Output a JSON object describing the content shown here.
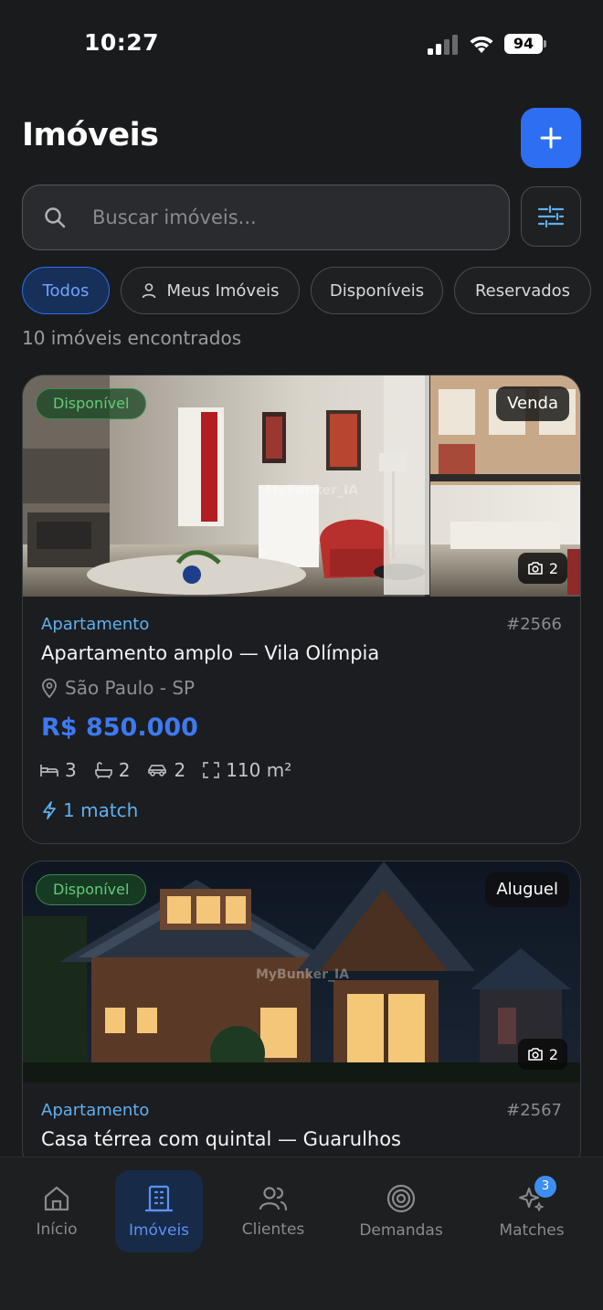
{
  "status_bar": {
    "time": "10:27",
    "battery": "94"
  },
  "header": {
    "title": "Imóveis"
  },
  "search": {
    "placeholder": "Buscar imóveis..."
  },
  "filters": [
    {
      "label": "Todos",
      "active": true
    },
    {
      "label": "Meus Imóveis",
      "active": false,
      "icon": "user-icon"
    },
    {
      "label": "Disponíveis",
      "active": false
    },
    {
      "label": "Reservados",
      "active": false
    }
  ],
  "results": {
    "count_text": "10 imóveis encontrados"
  },
  "listings": [
    {
      "status": "Disponível",
      "deal": "Venda",
      "photos": "2",
      "watermark": "MyBunker_IA",
      "type": "Apartamento",
      "code": "#2566",
      "title": "Apartamento amplo — Vila Olímpia",
      "location": "São Paulo - SP",
      "price": "R$ 850.000",
      "bedrooms": "3",
      "bathrooms": "2",
      "parking": "2",
      "area": "110 m²",
      "match": "1 match"
    },
    {
      "status": "Disponível",
      "deal": "Aluguel",
      "photos": "2",
      "watermark": "MyBunker_IA",
      "type": "Apartamento",
      "code": "#2567",
      "title": "Casa térrea com quintal — Guarulhos"
    }
  ],
  "tabbar": {
    "tabs": [
      {
        "label": "Início",
        "icon": "home-icon",
        "active": false
      },
      {
        "label": "Imóveis",
        "icon": "building-icon",
        "active": true
      },
      {
        "label": "Clientes",
        "icon": "users-icon",
        "active": false
      },
      {
        "label": "Demandas",
        "icon": "target-icon",
        "active": false
      },
      {
        "label": "Matches",
        "icon": "sparkles-icon",
        "active": false,
        "badge": "3"
      }
    ]
  },
  "colors": {
    "accent": "#2e6ef0",
    "status_green": "#63cc78",
    "link_blue": "#5fb0f0",
    "background": "#1a1b1d"
  }
}
